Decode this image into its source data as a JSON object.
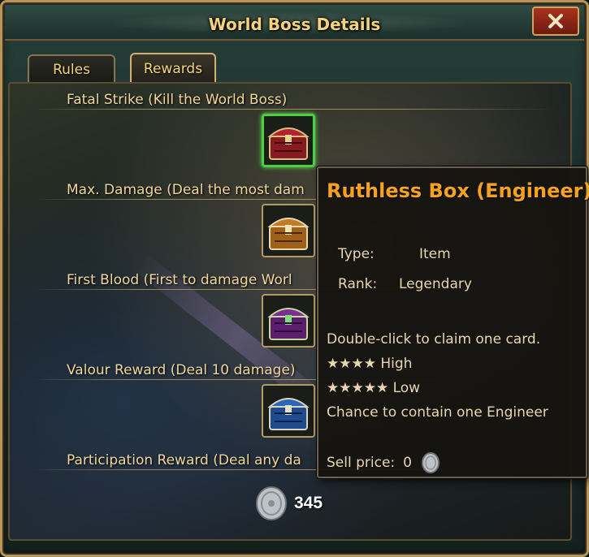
{
  "window": {
    "title": "World Boss Details"
  },
  "tabs": [
    {
      "label": "Rules",
      "active": false
    },
    {
      "label": "Rewards",
      "active": true
    }
  ],
  "rewards": [
    {
      "label": "Fatal Strike (Kill the World Boss)",
      "chest": "red-chest-icon",
      "selected": true
    },
    {
      "label": "Max. Damage (Deal the most dam",
      "chest": "orange-chest-icon",
      "selected": false
    },
    {
      "label": "First Blood (First to damage Worl",
      "chest": "purple-chest-icon",
      "selected": false
    },
    {
      "label": "Valour Reward (Deal 10 damage)",
      "chest": "blue-chest-icon",
      "selected": false
    },
    {
      "label": "Participation Reward (Deal any da",
      "chest": "",
      "selected": false
    }
  ],
  "coins": {
    "amount": "345",
    "icon": "silver-coin-icon"
  },
  "tooltip": {
    "title": "Ruthless Box (Engineer)",
    "type_label": "Type:",
    "type_value": "Item",
    "rank_label": "Rank:",
    "rank_value": "Legendary",
    "description": "Double-click to claim one card.",
    "line_high": "★★★★ High",
    "line_low": "★★★★★ Low",
    "line_chance": "Chance to contain one Engineer",
    "sell_label": "Sell price:",
    "sell_value": "0"
  },
  "colors": {
    "title_text": "#f3d27a",
    "tooltip_title": "#f6a11f",
    "selected_border": "#4bd13c",
    "close_button": "#a8321f"
  }
}
